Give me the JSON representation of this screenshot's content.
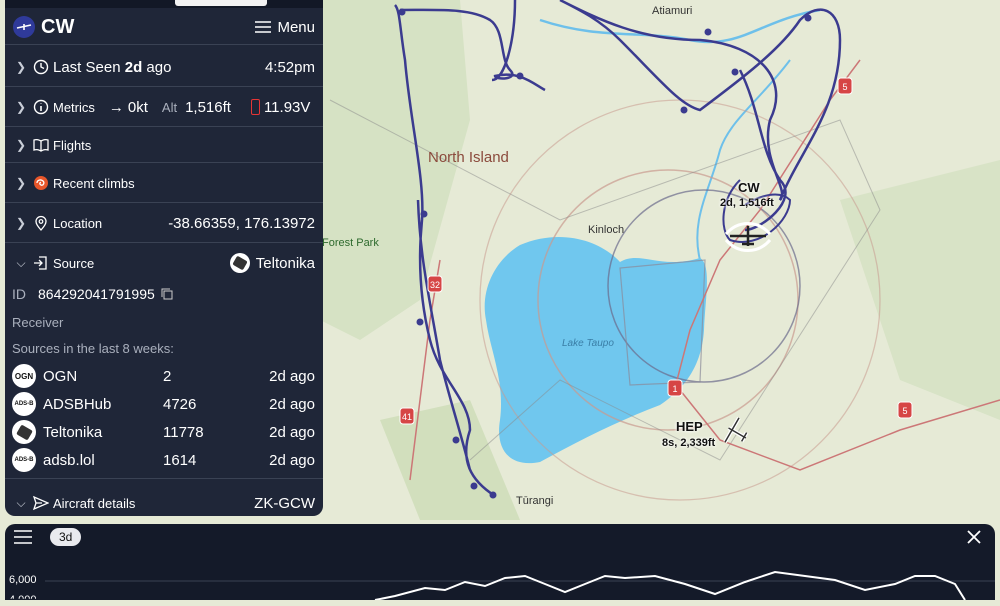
{
  "header": {
    "logo_text": "CW",
    "menu_label": "Menu"
  },
  "last_seen": {
    "prefix": "Last Seen",
    "value": "2d",
    "suffix": "ago",
    "time": "4:52pm"
  },
  "metrics": {
    "label": "Metrics",
    "speed": "0kt",
    "alt_label": "Alt",
    "alt_value": "1,516ft",
    "voltage": "11.93V"
  },
  "flights": {
    "label": "Flights"
  },
  "recent_climbs": {
    "label": "Recent climbs"
  },
  "location": {
    "label": "Location",
    "value": "-38.66359, 176.13972"
  },
  "source": {
    "label": "Source",
    "value": "Teltonika",
    "id_label": "ID",
    "id_value": "864292041791995",
    "receiver_label": "Receiver",
    "history_label": "Sources in the last 8 weeks:",
    "items": [
      {
        "badge": "OGN",
        "name": "OGN",
        "count": "2",
        "when": "2d ago"
      },
      {
        "badge": "ADS-B",
        "name": "ADSBHub",
        "count": "4726",
        "when": "2d ago"
      },
      {
        "badge": "",
        "name": "Teltonika",
        "count": "11778",
        "when": "2d ago"
      },
      {
        "badge": "ADS-B",
        "name": "adsb.lol",
        "count": "1614",
        "when": "2d ago"
      }
    ]
  },
  "aircraft_details": {
    "label": "Aircraft details",
    "value": "ZK-GCW"
  },
  "map": {
    "region_label": "North Island",
    "places": {
      "atiamuri": "Atiamuri",
      "kinloch": "Kinloch",
      "lake": "Lake Taupo",
      "turangi": "Tūrangi",
      "forest": "Forest Park"
    },
    "roads": {
      "r32": "32",
      "r41": "41",
      "r1": "1",
      "r5a": "5",
      "r5b": "5"
    },
    "aircraft": [
      {
        "name": "CW",
        "info": "2d, 1,516ft"
      },
      {
        "name": "HEP",
        "info": "8s, 2,339ft"
      }
    ],
    "colors": {
      "lake": "#70c7ee",
      "track": "#3b3b8f",
      "land": "#e6ead6"
    }
  },
  "bottom": {
    "range_pill": "3d",
    "y_tick_top": "6,000",
    "y_tick_partial": "4,000",
    "close_icon": "close-icon",
    "menu_icon": "hamburger-icon"
  }
}
